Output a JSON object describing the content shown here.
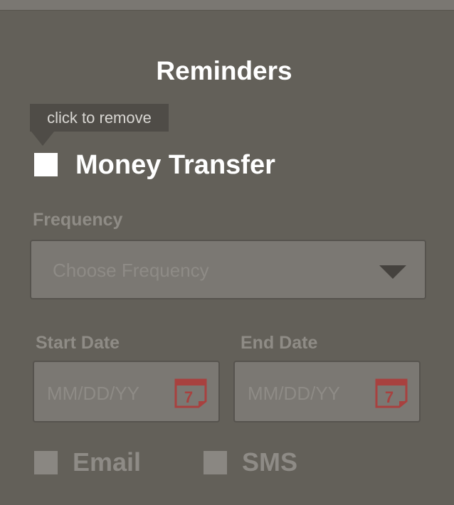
{
  "header": {
    "title": "Reminders"
  },
  "tooltip": {
    "text": "click to remove"
  },
  "reminder": {
    "label": "Money Transfer",
    "checked": true
  },
  "frequency": {
    "label": "Frequency",
    "placeholder": "Choose Frequency"
  },
  "start_date": {
    "label": "Start Date",
    "placeholder": "MM/DD/YY",
    "calendar_day": "7"
  },
  "end_date": {
    "label": "End Date",
    "placeholder": "MM/DD/YY",
    "calendar_day": "7"
  },
  "notify": {
    "email_label": "Email",
    "sms_label": "SMS",
    "email_checked": false,
    "sms_checked": false
  },
  "colors": {
    "background": "#636059",
    "field_background": "#7b7873",
    "calendar_icon": "#a8413f"
  },
  "icons": {
    "dropdown": "chevron-down-icon",
    "calendar": "calendar-icon"
  }
}
